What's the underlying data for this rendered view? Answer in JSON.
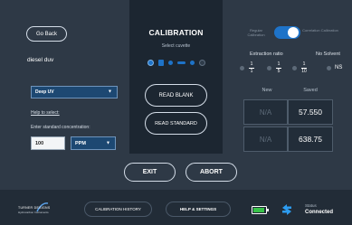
{
  "header": {
    "back_label": "Go Back",
    "title": "CALIBRATION",
    "select_cuvette_label": "Select cuvette",
    "regular_label": "Regular Calibration",
    "correlation_label": "Correlation Calibration"
  },
  "left": {
    "method_name": "diesel duv",
    "channel_select": "Deep UV",
    "help_link": "Help to select:",
    "conc_label": "Enter standard concentration:",
    "conc_value": "100",
    "unit_select": "PPM"
  },
  "center": {
    "read_blank": "READ BLANK",
    "read_standard": "READ STANDARD"
  },
  "right": {
    "extraction_label": "Extraction ratio",
    "no_solvent_label": "No Solvent",
    "ratios": [
      {
        "num": "1",
        "den": "1"
      },
      {
        "num": "1",
        "den": "5"
      },
      {
        "num": "1",
        "den": "10"
      }
    ],
    "ns_label": "NS",
    "new_header": "New",
    "saved_header": "Saved",
    "rows": [
      {
        "new": "N/A",
        "saved": "57.550"
      },
      {
        "new": "N/A",
        "saved": "638.75"
      }
    ]
  },
  "actions": {
    "exit": "EXIT",
    "abort": "ABORT"
  },
  "bottom": {
    "logo_line1": "TURNER DESIGNS",
    "logo_line2": "Hydrocarbon Instruments",
    "history": "CALIBRATION HISTORY",
    "help_settings": "HELP & SETTINGS",
    "status_label": "Status",
    "status_value": "Connected"
  },
  "colors": {
    "background": "#2e3946",
    "accent_blue": "#1e73c8",
    "battery_green": "#39c24a",
    "sync_blue": "#2d9cf0"
  },
  "icons": [
    "battery-icon",
    "sync-icon",
    "cuvette-selector"
  ]
}
